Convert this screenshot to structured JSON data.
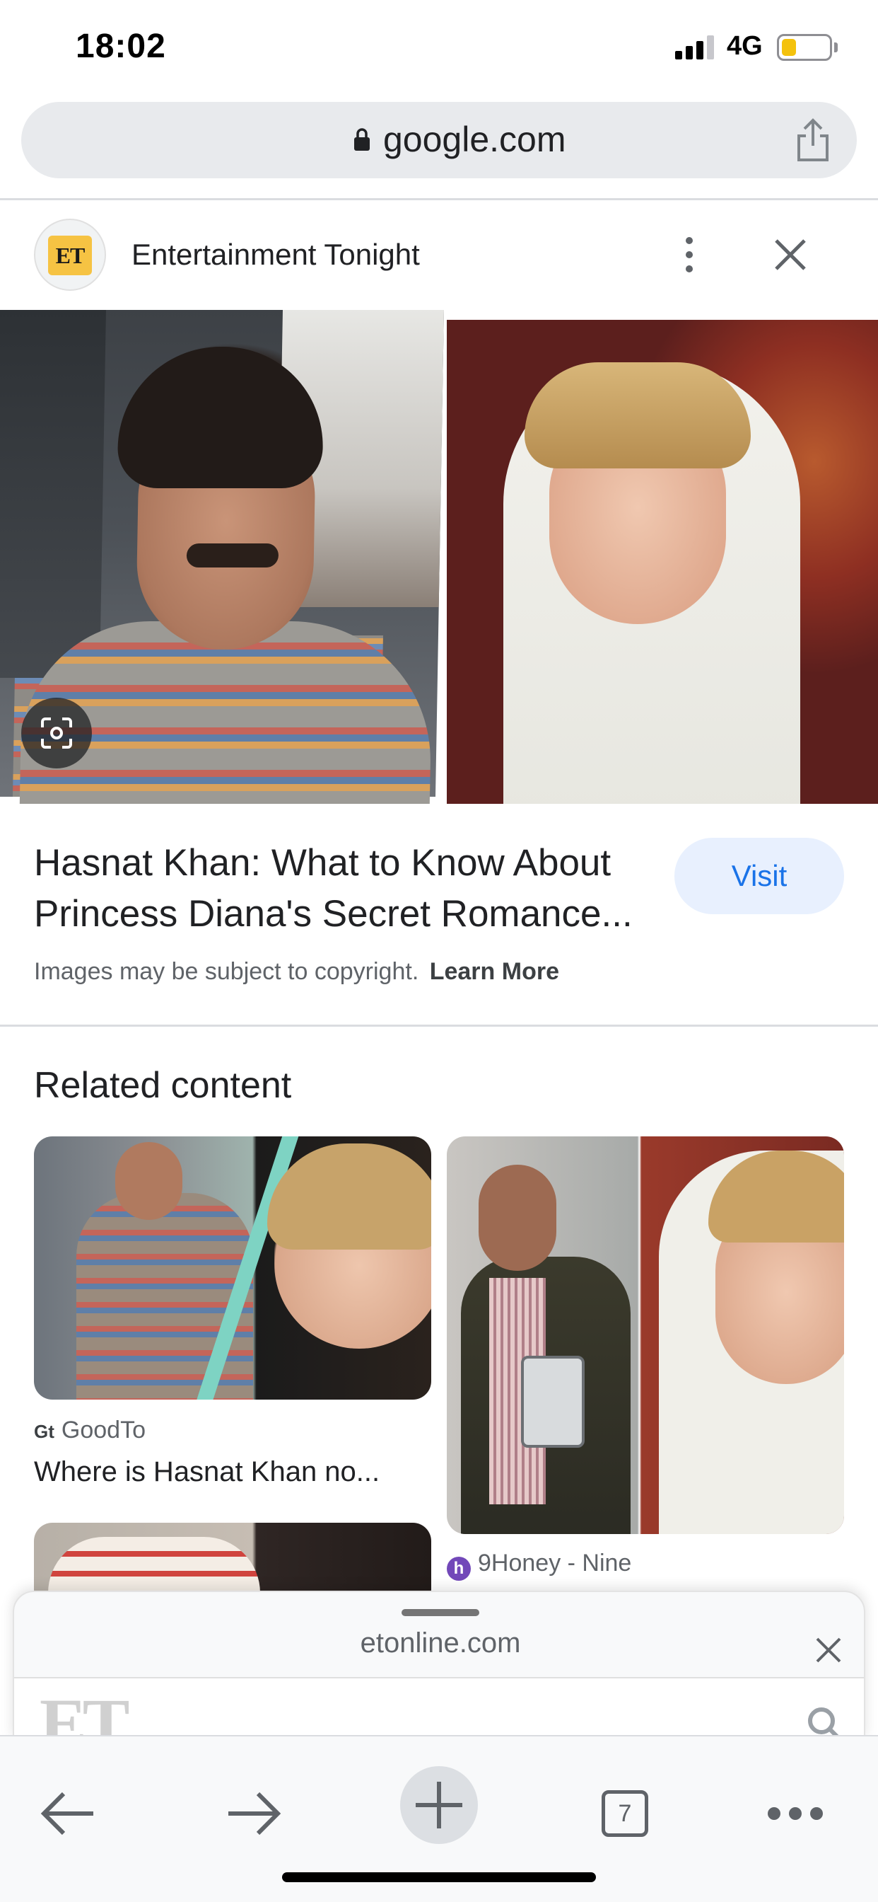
{
  "status_bar": {
    "time": "18:02",
    "network": "4G",
    "battery_level": 0.3,
    "battery_color": "#f4c20d"
  },
  "url_bar": {
    "domain": "google.com",
    "lock_icon": "lock-icon",
    "share_icon": "share-icon"
  },
  "source": {
    "logo_text": "ET",
    "name": "Entertainment Tonight"
  },
  "result": {
    "title": "Hasnat Khan: What to Know About Princess Diana's Secret Romance...",
    "visit_label": "Visit",
    "copyright_text": "Images may be subject to copyright.",
    "learn_more_label": "Learn More"
  },
  "related": {
    "heading": "Related content",
    "cards": [
      {
        "source_badge": "Gt",
        "source": "GoodTo",
        "title": "Where is Hasnat Khan no..."
      },
      {
        "source_badge": "h",
        "source": "9Honey - Nine",
        "title": ""
      },
      {
        "source": "",
        "title": ""
      }
    ]
  },
  "bottom_sheet": {
    "url": "etonline.com",
    "logo_text": "ET"
  },
  "toolbar": {
    "tab_count": "7"
  },
  "colors": {
    "accent": "#1a73e8",
    "visit_bg": "#e8f0fe",
    "et_yellow": "#f6c343"
  }
}
